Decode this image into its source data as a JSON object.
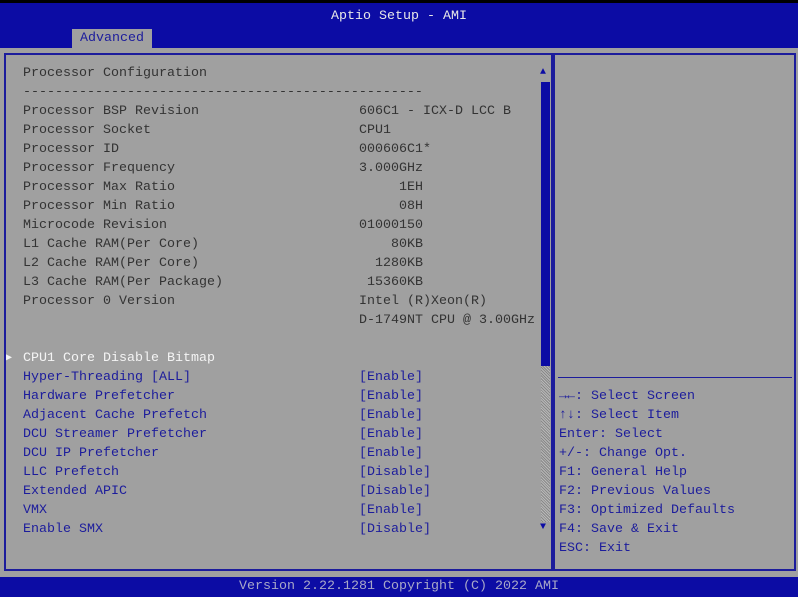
{
  "header": {
    "title": "Aptio Setup - AMI",
    "tab": "Advanced"
  },
  "section_title": "Processor Configuration",
  "separator": "--------------------------------------------------",
  "info": [
    {
      "label": "Processor BSP Revision",
      "value": "606C1 - ICX-D LCC B"
    },
    {
      "label": "Processor Socket",
      "value": "CPU1"
    },
    {
      "label": "Processor ID",
      "value": "000606C1*"
    },
    {
      "label": "Processor Frequency",
      "value": "3.000GHz"
    },
    {
      "label": "Processor Max Ratio",
      "value": "     1EH"
    },
    {
      "label": "Processor Min Ratio",
      "value": "     08H"
    },
    {
      "label": "Microcode Revision",
      "value": "01000150"
    },
    {
      "label": "L1 Cache RAM(Per Core)",
      "value": "    80KB"
    },
    {
      "label": "L2 Cache RAM(Per Core)",
      "value": "  1280KB"
    },
    {
      "label": "L3 Cache RAM(Per Package)",
      "value": " 15360KB"
    },
    {
      "label": "Processor 0 Version",
      "value": "Intel (R)Xeon(R)"
    },
    {
      "label": "",
      "value": "D-1749NT CPU @ 3.00GHz"
    }
  ],
  "submenu": "CPU1 Core Disable Bitmap",
  "options": [
    {
      "label": "Hyper-Threading [ALL]",
      "value": "[Enable]"
    },
    {
      "label": "Hardware Prefetcher",
      "value": "[Enable]"
    },
    {
      "label": "Adjacent Cache Prefetch",
      "value": "[Enable]"
    },
    {
      "label": "DCU Streamer Prefetcher",
      "value": "[Enable]"
    },
    {
      "label": "DCU IP Prefetcher",
      "value": "[Enable]"
    },
    {
      "label": "LLC Prefetch",
      "value": "[Disable]"
    },
    {
      "label": "Extended APIC",
      "value": "[Disable]"
    },
    {
      "label": "VMX",
      "value": "[Enable]"
    },
    {
      "label": "Enable SMX",
      "value": "[Disable]"
    }
  ],
  "help": [
    "→←: Select Screen",
    "↑↓: Select Item",
    "Enter: Select",
    "+/-: Change Opt.",
    "F1: General Help",
    "F2: Previous Values",
    "F3: Optimized Defaults",
    "F4: Save & Exit",
    "ESC: Exit"
  ],
  "footer": "Version 2.22.1281 Copyright (C) 2022 AMI"
}
